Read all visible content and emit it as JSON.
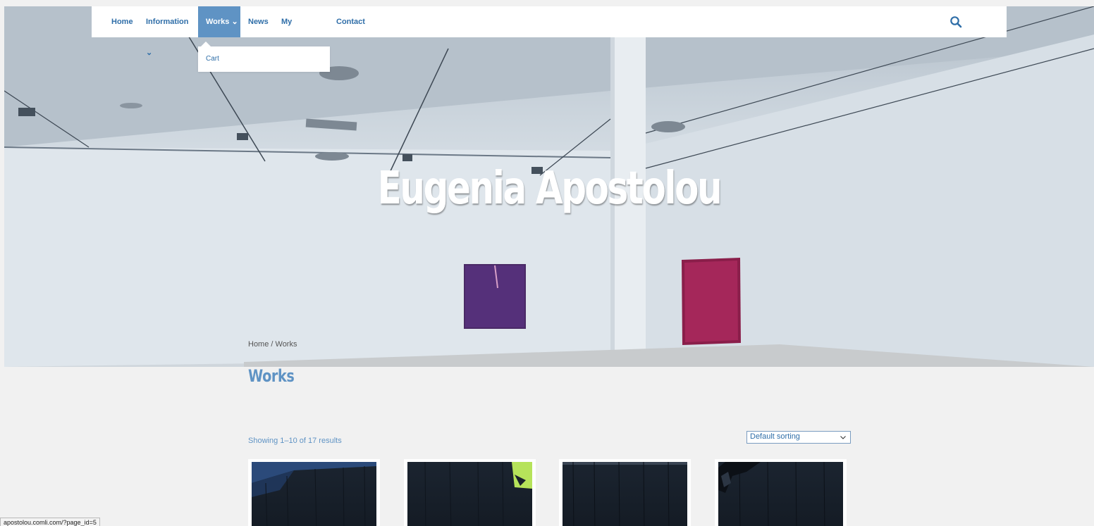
{
  "nav": {
    "items": [
      {
        "label": "Home"
      },
      {
        "label": "Information ⌄"
      },
      {
        "label": "Works ⌄"
      },
      {
        "label": "News"
      },
      {
        "label": "My Account"
      },
      {
        "label": "Contact"
      }
    ],
    "search_icon": "search-icon",
    "dropdown": {
      "items": [
        {
          "label": "Cart"
        }
      ]
    }
  },
  "hero": {
    "title": "Eugenia Apostolou",
    "breadcrumb": "Home / Works"
  },
  "content": {
    "title": "Works",
    "result_count": "Showing 1–10 of 17 results",
    "sort": {
      "selected": "Default sorting"
    }
  },
  "status_bar": {
    "url": "apostolou.comli.com/?page_id=5"
  },
  "colors": {
    "accent": "#5f93c4",
    "link": "#2f6ea8",
    "background": "#f1f1f1"
  }
}
